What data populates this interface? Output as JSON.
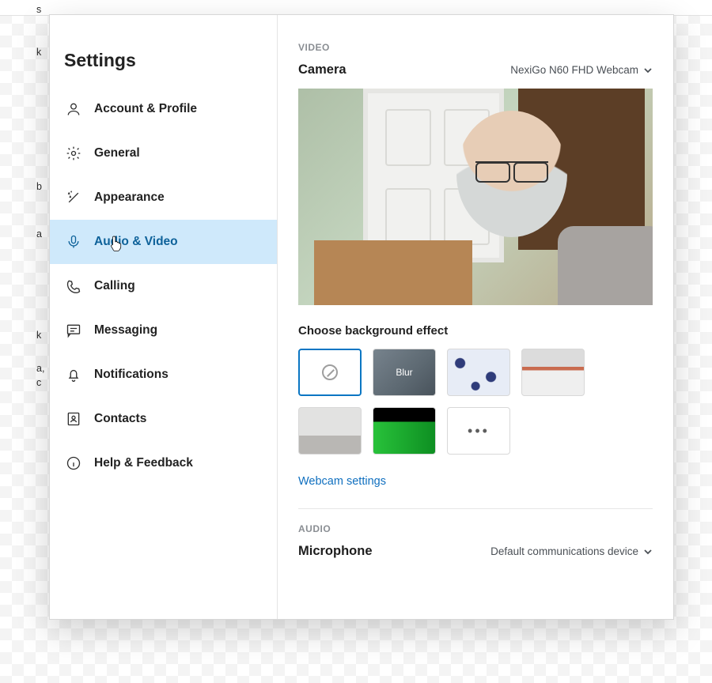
{
  "background_snippets": [
    "s",
    "k",
    "b",
    "a",
    "k",
    "a,",
    "c"
  ],
  "sidebar": {
    "title": "Settings",
    "items": [
      {
        "label": "Account & Profile"
      },
      {
        "label": "General"
      },
      {
        "label": "Appearance"
      },
      {
        "label": "Audio & Video"
      },
      {
        "label": "Calling"
      },
      {
        "label": "Messaging"
      },
      {
        "label": "Notifications"
      },
      {
        "label": "Contacts"
      },
      {
        "label": "Help & Feedback"
      }
    ],
    "active_index": 3
  },
  "video": {
    "section_label": "VIDEO",
    "camera_label": "Camera",
    "camera_value": "NexiGo N60 FHD Webcam",
    "bg_heading": "Choose background effect",
    "effects": {
      "blur_label": "Blur",
      "more_label": "•••"
    },
    "webcam_settings_link": "Webcam settings"
  },
  "audio": {
    "section_label": "AUDIO",
    "mic_label": "Microphone",
    "mic_value": "Default communications device"
  }
}
